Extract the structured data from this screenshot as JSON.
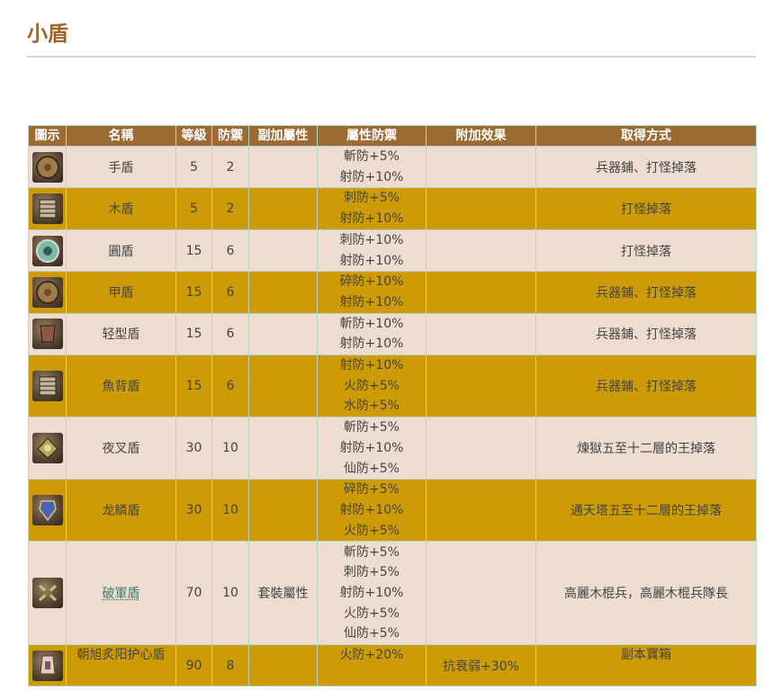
{
  "page": {
    "title": "小盾"
  },
  "table": {
    "headers": [
      "圖示",
      "名稱",
      "等級",
      "防禦",
      "副加屬性",
      "屬性防禦",
      "附加效果",
      "取得方式"
    ],
    "rows": [
      {
        "icon": "round-wooden-shield-icon",
        "name": "手盾",
        "level": "5",
        "defense": "2",
        "extra": "",
        "res": [
          "斬防+5%",
          "射防+10%"
        ],
        "effect": "",
        "source": "兵器鋪、打怪掉落"
      },
      {
        "icon": "slat-shield-icon",
        "name": "木盾",
        "level": "5",
        "defense": "2",
        "extra": "",
        "res": [
          "刺防+5%",
          "射防+10%"
        ],
        "effect": "",
        "source": "打怪掉落"
      },
      {
        "icon": "round-teal-shield-icon",
        "name": "圓盾",
        "level": "15",
        "defense": "6",
        "extra": "",
        "res": [
          "刺防+10%",
          "射防+10%"
        ],
        "effect": "",
        "source": "打怪掉落"
      },
      {
        "icon": "round-wooden-shield-icon",
        "name": "甲盾",
        "level": "15",
        "defense": "6",
        "extra": "",
        "res": [
          "碎防+10%",
          "射防+10%"
        ],
        "effect": "",
        "source": "兵器鋪、打怪掉落"
      },
      {
        "icon": "light-shield-icon",
        "name": "轻型盾",
        "level": "15",
        "defense": "6",
        "extra": "",
        "res": [
          "斬防+10%",
          "射防+10%"
        ],
        "effect": "",
        "source": "兵器鋪、打怪掉落"
      },
      {
        "icon": "slat-shield-icon",
        "name": "魚背盾",
        "level": "15",
        "defense": "6",
        "extra": "",
        "res": [
          "射防+10%",
          "火防+5%",
          "水防+5%"
        ],
        "effect": "",
        "source": "兵器鋪、打怪掉落"
      },
      {
        "icon": "spiked-shield-icon",
        "name": "夜叉盾",
        "level": "30",
        "defense": "10",
        "extra": "",
        "res": [
          "斬防+5%",
          "射防+10%",
          "仙防+5%"
        ],
        "effect": "",
        "source": "煉獄五至十二層的王掉落"
      },
      {
        "icon": "dragon-scale-shield-icon",
        "name": "龙鳞盾",
        "level": "30",
        "defense": "10",
        "extra": "",
        "res": [
          "碎防+5%",
          "射防+10%",
          "火防+5%"
        ],
        "effect": "",
        "source": "通天塔五至十二層的王掉落"
      },
      {
        "icon": "army-breaker-shield-icon",
        "name": "破軍盾",
        "level": "70",
        "defense": "10",
        "extra": "套裝屬性",
        "res": [
          "斬防+5%",
          "刺防+5%",
          "射防+10%",
          "火防+5%",
          "仙防+5%"
        ],
        "effect": "",
        "source": "高麗木棍兵，高麗木棍兵隊長",
        "link": true
      },
      {
        "icon": "sun-guardian-shield-icon",
        "name": "朝旭炙阳护心盾",
        "level": "90",
        "defense": "8",
        "extra": "",
        "res": [
          "火防+20%"
        ],
        "effect": "抗衰弱+30%",
        "source": "副本寶箱",
        "top": true
      }
    ]
  },
  "colors": {
    "header": "#9c6a33",
    "row_light": "#eddcd0",
    "row_dark": "#cc9b05",
    "title": "#a0622a"
  }
}
